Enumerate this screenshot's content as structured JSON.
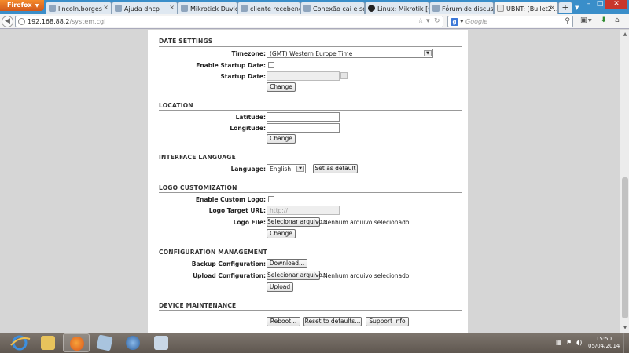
{
  "browser": {
    "menu_label": "Firefox",
    "tabs": [
      {
        "title": "lincoln.borges",
        "icon": "page-icon"
      },
      {
        "title": "Ajuda dhcp",
        "icon": "page-icon"
      },
      {
        "title": "Mikrotick Duvidas i...",
        "icon": "page-icon"
      },
      {
        "title": "cliente recebendo i...",
        "icon": "page-icon"
      },
      {
        "title": "Conexão cai e só v...",
        "icon": "page-icon"
      },
      {
        "title": "Linux: Mikrotik [Co...",
        "icon": "github-icon"
      },
      {
        "title": "Fórum de discussã...",
        "icon": "page-icon"
      },
      {
        "title": "UBNT: [Bullet2 ...",
        "icon": "generic-page-icon",
        "active": true
      }
    ],
    "url_host": "192.168.88.2",
    "url_path": "/system.cgi",
    "search_placeholder": "Google"
  },
  "page": {
    "date_settings": {
      "title": "DATE SETTINGS",
      "timezone_label": "Timezone:",
      "timezone_value": "(GMT) Western Europe Time",
      "enable_startup_label": "Enable Startup Date:",
      "startup_date_label": "Startup Date:",
      "change_label": "Change"
    },
    "location": {
      "title": "LOCATION",
      "latitude_label": "Latitude:",
      "longitude_label": "Longitude:",
      "change_label": "Change"
    },
    "interface_language": {
      "title": "INTERFACE LANGUAGE",
      "language_label": "Language:",
      "language_value": "English",
      "set_default_label": "Set as default"
    },
    "logo_customization": {
      "title": "LOGO CUSTOMIZATION",
      "enable_custom_logo_label": "Enable Custom Logo:",
      "logo_target_url_label": "Logo Target URL:",
      "logo_target_url_placeholder": "http://",
      "logo_file_label": "Logo File:",
      "choose_file_label": "Selecionar arquivo...",
      "no_file_text": "Nenhum arquivo selecionado.",
      "change_label": "Change"
    },
    "configuration_management": {
      "title": "CONFIGURATION MANAGEMENT",
      "backup_label": "Backup Configuration:",
      "download_label": "Download...",
      "upload_label": "Upload Configuration:",
      "choose_file_label": "Selecionar arquivo...",
      "no_file_text": "Nenhum arquivo selecionado.",
      "upload_button_label": "Upload"
    },
    "device_maintenance": {
      "title": "DEVICE MAINTENANCE",
      "reboot_label": "Reboot...",
      "reset_label": "Reset to defaults...",
      "support_label": "Support Info"
    }
  },
  "taskbar": {
    "time": "15:50",
    "date": "05/04/2014"
  },
  "colors": {
    "tabbar": "#3a8ec9",
    "firefox_button": "#e2732a",
    "close_button": "#c7362b",
    "taskbar": "#6e665f"
  }
}
